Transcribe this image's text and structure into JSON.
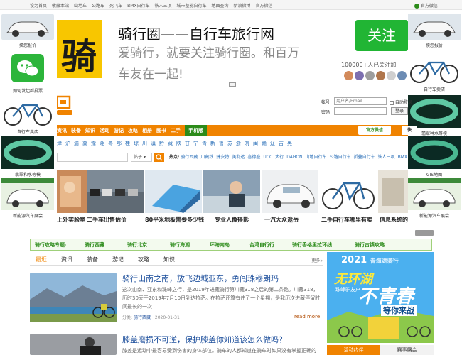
{
  "topbar": {
    "links": [
      "设为首页",
      "收藏本站",
      "山地车",
      "公路车",
      "死飞车",
      "BMX自行车",
      "铁人三项",
      "城市整能自行车",
      "地图查询",
      "新浪微博",
      "官方微信"
    ],
    "right_wechat": "官方微信"
  },
  "left_col": {
    "items": [
      {
        "caption": "摸您报价"
      },
      {
        "caption": "如何发起群投票"
      },
      {
        "caption": "自行车卖店"
      },
      {
        "caption": "翡翠和水等模"
      },
      {
        "caption": "新能源汽车展会"
      }
    ]
  },
  "right_col": {
    "items": [
      {
        "caption": "摸您报价"
      },
      {
        "caption": "自行车卖店"
      },
      {
        "caption": "翡翠种水等模"
      },
      {
        "caption": "GIS地图"
      },
      {
        "caption": "新能源汽车展会"
      }
    ]
  },
  "banner": {
    "logo_char": "骑",
    "title": "骑行圈——自行车旅行网",
    "line2": "爱骑行，就要关注骑行圈。和百万",
    "line3": "车友在一起!",
    "follow_label": "关注",
    "count": "100000+人已关注加"
  },
  "login": {
    "account_label": "帐号",
    "account_placeholder": "用户名/Email",
    "auto_login": "自动登录",
    "password_label": "密码",
    "login_button": "登录"
  },
  "nav": {
    "items": [
      "资讯",
      "装备",
      "知识",
      "活动",
      "游记",
      "攻略",
      "相册",
      "图书",
      "二手",
      "手机版"
    ],
    "wechat": "官方微信",
    "more": "快"
  },
  "regions": [
    "北京",
    "津",
    "沪",
    "渝",
    "冀",
    "豫",
    "湘",
    "粤",
    "鄂",
    "桂",
    "琼",
    "川",
    "滇",
    "黔",
    "藏",
    "陕",
    "甘",
    "宁",
    "青",
    "新",
    "鲁",
    "苏",
    "浙",
    "皖",
    "闽",
    "赣",
    "辽",
    "吉",
    "黑",
    "晋",
    "蒙",
    "港",
    "澳",
    "台"
  ],
  "regions_text": "北京 津 沪 渝 冀 豫 湘 粤 鄂 桂 琼 川 滇 黔 藏 浙 闽 苏 皖 陕 甘 宁 新 藏 青 蒙 黑 辽 吉",
  "search": {
    "select_label": "帖子",
    "hot_label": "热点:",
    "hot_items": [
      "骑行西藏",
      "川藏线",
      "捷安特",
      "美利达",
      "喜德盛",
      "UCC",
      "大行",
      "DAHON",
      "山地自行车",
      "公路自行车",
      "折叠自行车",
      "铁人三项",
      "BMX"
    ]
  },
  "gallery": {
    "captions": [
      "上外实验室",
      "二手车出售估价",
      "80平米地板需要多少钱",
      "专业人像摄影",
      "一汽大众途岳",
      "二手自行车哪里有卖",
      "信息系统的"
    ]
  },
  "band": {
    "label": "骑行攻略专题:",
    "items": [
      "骑行西藏",
      "骑行北京",
      "骑行海湖",
      "环海南岛",
      "台湾自行行",
      "骑行香格里拉环线",
      "骑行古镇攻略"
    ]
  },
  "tabs": {
    "items": [
      "最近",
      "资讯",
      "装备",
      "游记",
      "攻略",
      "知识"
    ],
    "more": "更多»"
  },
  "articles": [
    {
      "title": "骑行山南之南，放飞边城亚东，勇闯珠穆朗玛",
      "body": "这次山南、亚东和珠峰之行，是2019年进藏骑行第川藏318之后的第二条路。川藏318，历时30天于2019年7月10日到达拉萨。在拉萨还算有住了一个星期，是我历次进藏停留时间最长的一次",
      "category_label": "分类:",
      "category": "骑行西藏",
      "date": "2020-01-31",
      "read_more": "read more"
    },
    {
      "title": "膝盖磨损不可逆，保护膝盖你知道该怎么做吗？",
      "body": "膝盖是运动中最容易受到伤害的身体部位。骑车的人都知道在骑车时如果没有掌握正确的"
    }
  ],
  "right_ad": {
    "year": "2021",
    "subtitle": "青海湖骑行",
    "line1": "无环湖",
    "line2": "不青春",
    "line3": "等你来战",
    "brand": "珠峰驴友户"
  },
  "right_tabs": [
    "活动约伴",
    "赛事展会"
  ],
  "colors": {
    "nav_orange": "#f08300",
    "accent_green": "#2c8b1a",
    "link_blue": "#1d4f9c",
    "follow_green": "#21b534",
    "logo_yellow": "#f8c600"
  }
}
